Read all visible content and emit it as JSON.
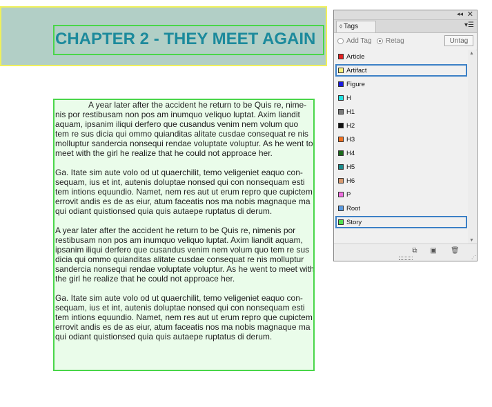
{
  "layout": {
    "chapter_title": "CHAPTER 2 - THEY MEET AGAIN",
    "story_paragraphs": [
      [
        "A year later after the accident he return to be Quis re, nime-",
        "nis por restibusam non pos am inumquo veliquo luptat. Axim liandit",
        "aquam, ipsanim iliqui derfero que cusandus venim nem volum quo",
        "tem re sus dicia qui ommo quianditas alitate cusdae consequat re nis",
        "molluptur sandercia nonsequi rendae voluptate voluptur. As he went to",
        "meet with the girl he realize that he could not approace her."
      ],
      [
        "Ga. Itate sim aute volo od ut quaerchilit, temo veligeniet eaquo con-",
        "sequam, ius et int, autenis doluptae nonsed qui con nonsequam esti",
        "tem intions equundio. Namet, nem res aut ut erum repro que cupictem",
        "errovit andis es de as eiur, atum faceatis nos ma nobis magnaque ma",
        "qui odiant quistionsed quia quis autaepe ruptatus di derum."
      ],
      [
        "A year later after the accident he return to be Quis re, nimenis por",
        "restibusam non pos am inumquo veliquo luptat. Axim liandit aquam,",
        "ipsanim iliqui derfero que cusandus venim nem volum quo tem re sus",
        "dicia qui ommo quianditas alitate cusdae consequat re nis molluptur",
        "sandercia nonsequi rendae voluptate voluptur. As he went to meet with",
        "the girl he realize that he could not approace her."
      ],
      [
        "Ga. Itate sim aute volo od ut quaerchilit, temo veligeniet eaquo con-",
        "sequam, ius et int, autenis doluptae nonsed qui con nonsequam esti",
        "tem intions equundio. Namet, nem res aut ut erum repro que cupictem",
        "errovit andis es de as eiur, atum faceatis nos ma nobis magnaque ma",
        "qui odiant quistionsed quia quis autaepe ruptatus di derum."
      ]
    ]
  },
  "panel": {
    "tab_label": "Tags",
    "collapse_glyph": "◂◂",
    "close_glyph": "✕",
    "menu_glyph": "▾☰",
    "add_tag_label": "Add Tag",
    "retag_label": "Retag",
    "untag_label": "Untag",
    "tags": [
      {
        "name": "Article",
        "color": "#e02020",
        "selected": false
      },
      {
        "name": "Artifact",
        "color": "#f5f07a",
        "selected": true
      },
      {
        "name": "Figure",
        "color": "#1a1ae0",
        "selected": false
      },
      {
        "name": "H",
        "color": "#20e0e0",
        "selected": false
      },
      {
        "name": "H1",
        "color": "#7a7a7a",
        "selected": false
      },
      {
        "name": "H2",
        "color": "#111111",
        "selected": false
      },
      {
        "name": "H3",
        "color": "#f07020",
        "selected": false
      },
      {
        "name": "H4",
        "color": "#1a6a1a",
        "selected": false
      },
      {
        "name": "H5",
        "color": "#1a8a8a",
        "selected": false
      },
      {
        "name": "H6",
        "color": "#d89a70",
        "selected": false
      },
      {
        "name": "P",
        "color": "#f070e0",
        "selected": false
      },
      {
        "name": "Root",
        "color": "#5a9ae0",
        "selected": false
      },
      {
        "name": "Story",
        "color": "#50e050",
        "selected": true
      }
    ],
    "bottom_icons": [
      "new-structure-icon",
      "new-tag-icon",
      "delete-tag-icon"
    ]
  }
}
